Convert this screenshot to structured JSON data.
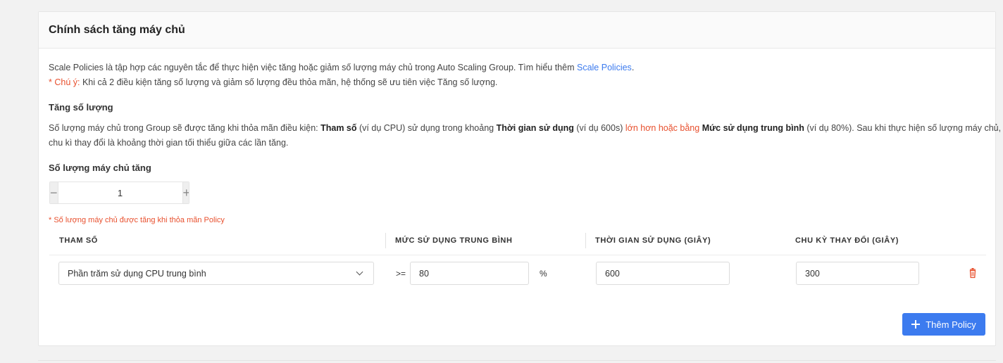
{
  "card": {
    "title": "Chính sách tăng máy chủ"
  },
  "intro": {
    "text": "Scale Policies là tập hợp các nguyên tắc để thực hiện việc tăng hoặc giảm số lượng máy chủ trong Auto Scaling Group. Tìm hiểu thêm ",
    "link": "Scale Policies",
    "link_suffix": ".",
    "note_label": "* Chú ý:",
    "note_text": " Khi cả 2 điều kiện tăng số lượng và giảm số lượng đều thỏa mãn, hệ thống sẽ ưu tiên việc Tăng số lượng."
  },
  "increase": {
    "title": "Tăng số lượng",
    "d1": "Số lượng máy chủ trong Group sẽ được tăng khi thỏa mãn điều kiện: ",
    "b1": "Tham số",
    "d2": " (ví dụ CPU) sử dụng trong khoảng ",
    "b2": "Thời gian sử dụng",
    "d3": " (ví dụ 600s) ",
    "r1": "lớn hơn hoặc bằng",
    "d4": " ",
    "b3": "Mức sử dụng trung bình",
    "d5": " (ví dụ 80%). Sau khi thực hiện số lượng máy chủ,",
    "line2": "chu kì thay đổi là khoảng thời gian tối thiểu giữa các lần tăng."
  },
  "quantity": {
    "label": "Số lượng máy chủ tăng",
    "value": "1",
    "minus": "−",
    "plus": "+",
    "note": "* Số lượng máy chủ được tăng khi thỏa mãn Policy"
  },
  "table": {
    "headers": [
      "THAM SỐ",
      "MỨC SỬ DỤNG TRUNG BÌNH",
      "THỜI GIAN SỬ DỤNG (GIÂY)",
      "CHU KỲ THAY ĐỔI (GIÂY)"
    ],
    "row": {
      "param": "Phần trăm sử dụng CPU trung bình",
      "operator": ">=",
      "avg_usage": "80",
      "unit": "%",
      "duration": "600",
      "cycle": "300"
    }
  },
  "actions": {
    "add_policy": "Thêm Policy"
  },
  "colors": {
    "accent": "#3c7bef",
    "danger": "#e8502e"
  },
  "icons": {
    "trash": "trash-icon",
    "dropdown": "chevron-down-icon",
    "add": "plus-icon"
  }
}
